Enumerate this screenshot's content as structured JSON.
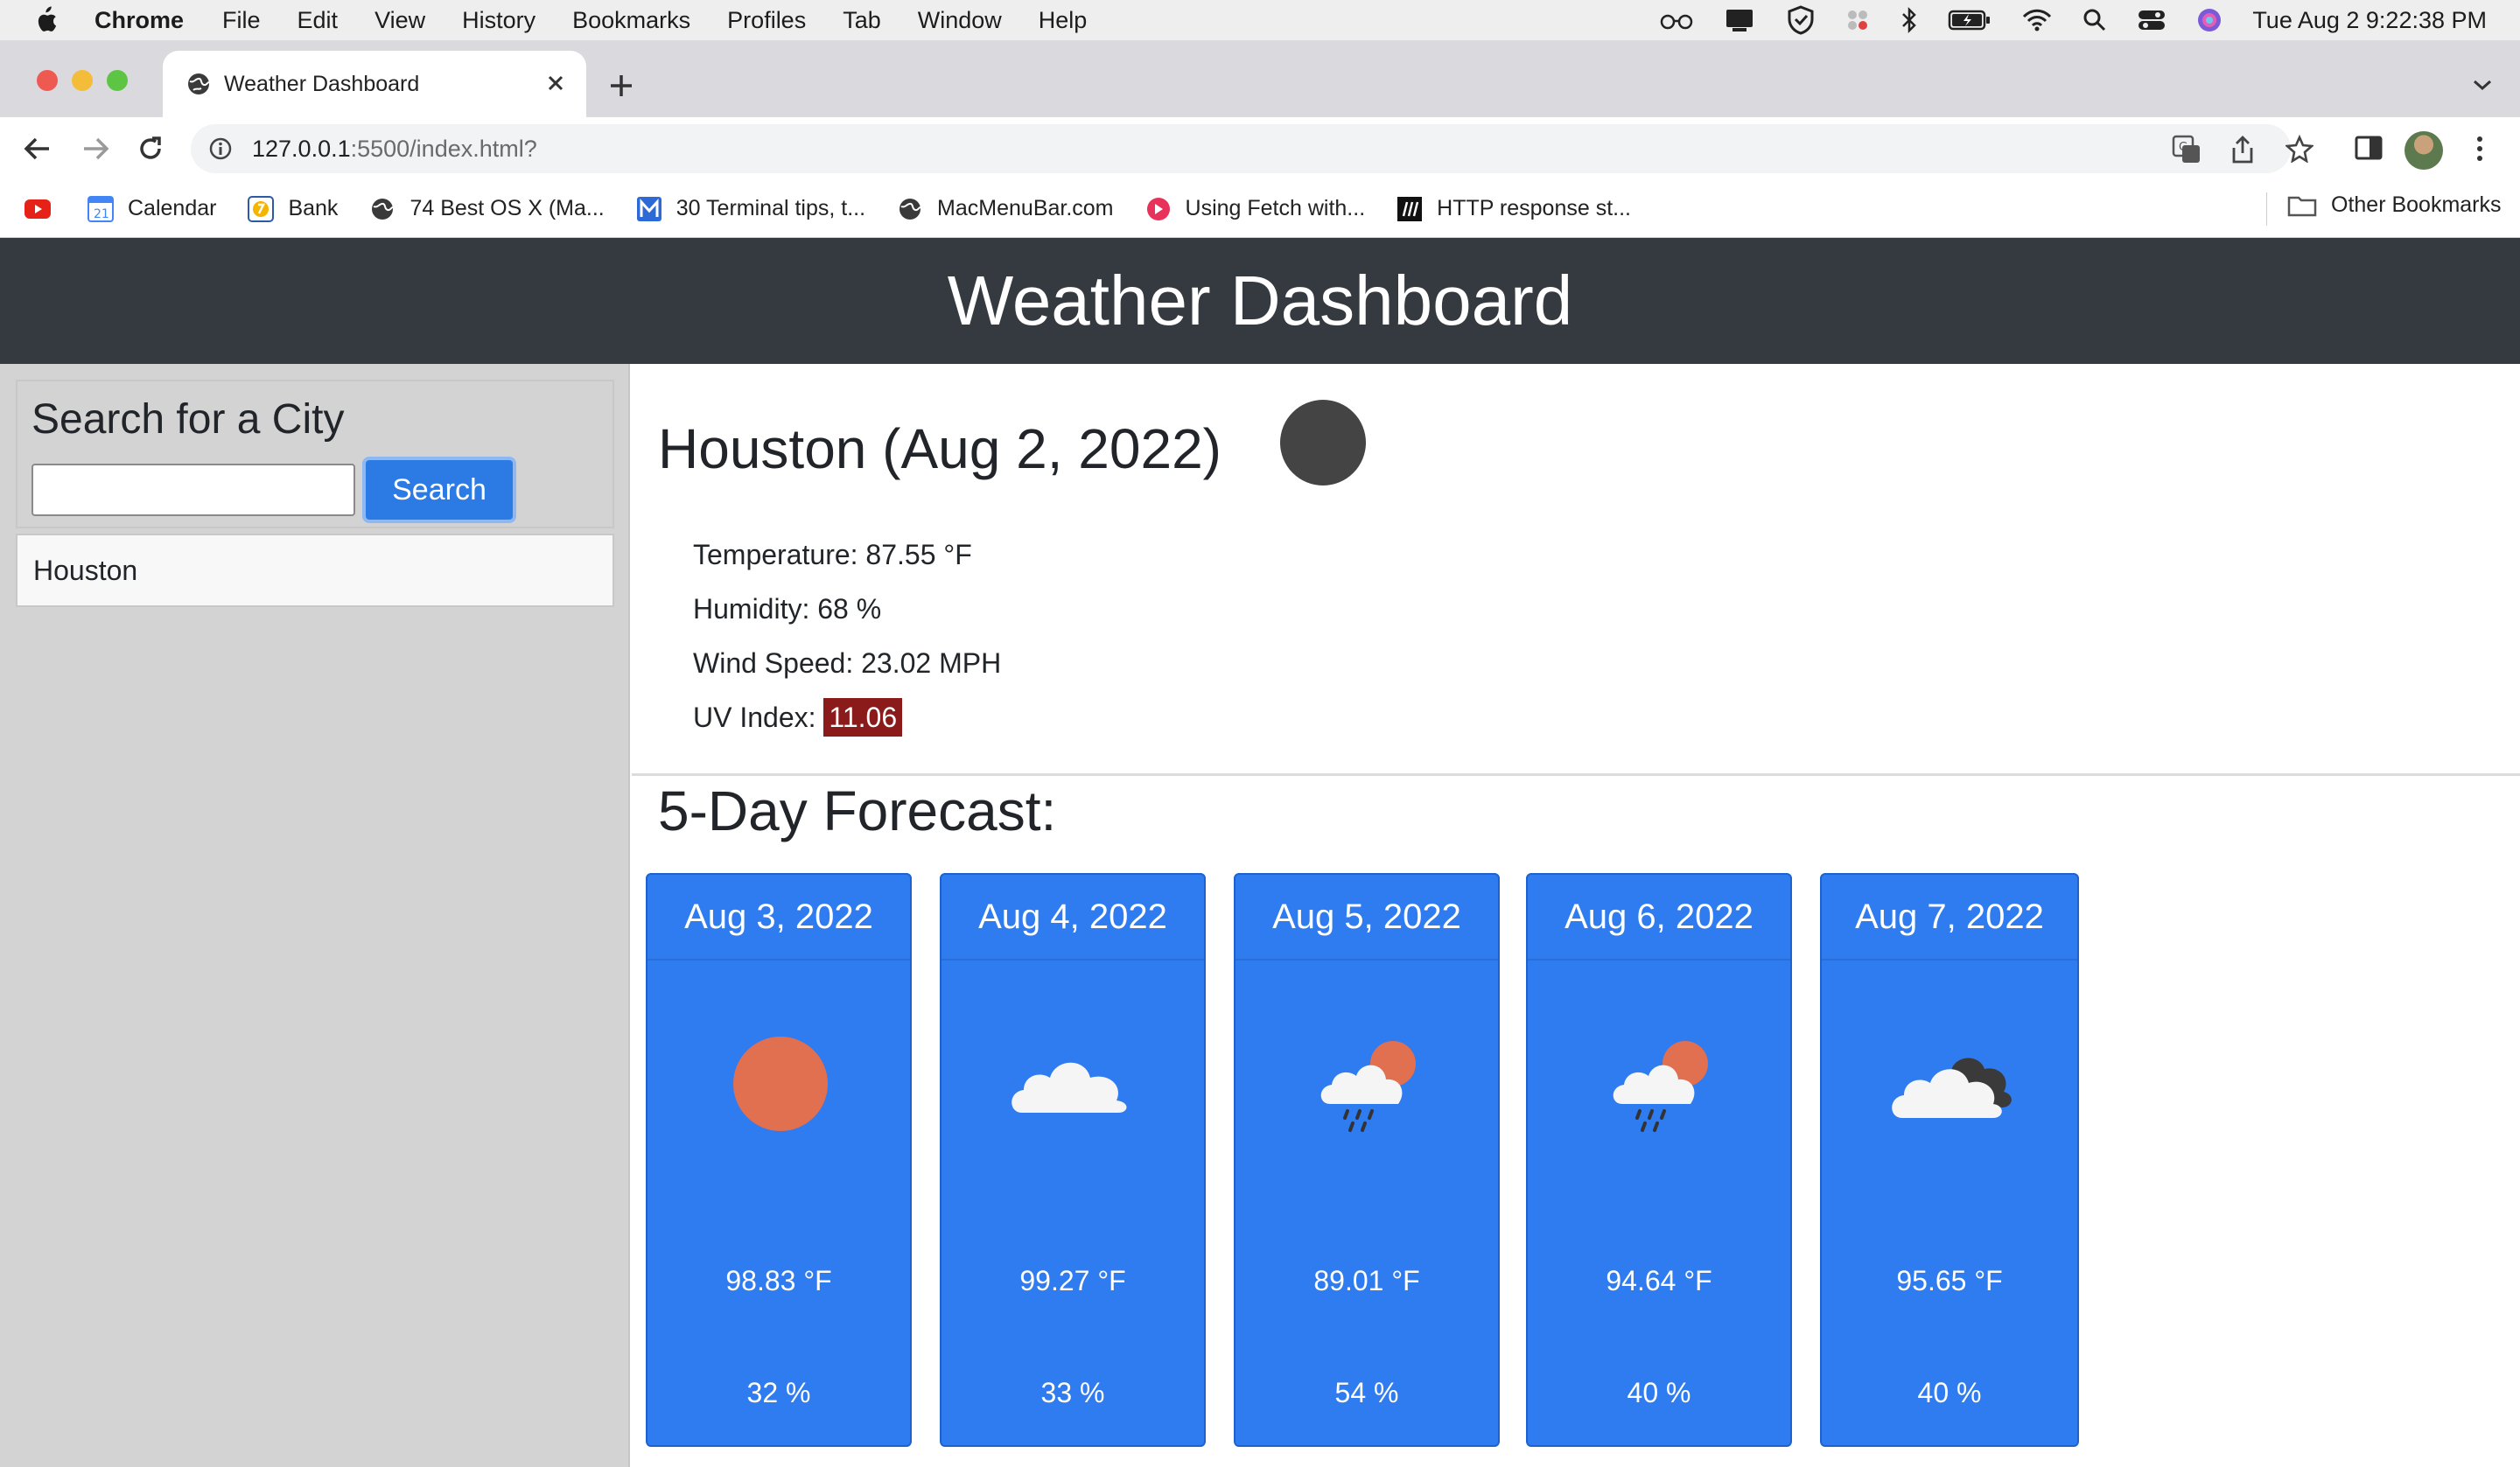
{
  "menubar": {
    "app_name": "Chrome",
    "items": [
      "File",
      "Edit",
      "View",
      "History",
      "Bookmarks",
      "Profiles",
      "Tab",
      "Window",
      "Help"
    ],
    "clock": "Tue Aug 2  9:22:38 PM"
  },
  "browser": {
    "tab_title": "Weather Dashboard",
    "url_host": "127.0.0.1",
    "url_rest": ":5500/index.html?",
    "bookmarks": [
      {
        "label": "",
        "icon": "youtube-icon"
      },
      {
        "label": "Calendar",
        "icon": "calendar-icon"
      },
      {
        "label": "Bank",
        "icon": "bank-icon"
      },
      {
        "label": "74 Best OS X (Ma...",
        "icon": "globe-icon"
      },
      {
        "label": "30 Terminal tips, t...",
        "icon": "m-logo-icon"
      },
      {
        "label": "MacMenuBar.com",
        "icon": "globe-icon"
      },
      {
        "label": "Using Fetch with...",
        "icon": "red-circle-icon"
      },
      {
        "label": "HTTP response st...",
        "icon": "mdn-icon"
      }
    ],
    "other_bookmarks": "Other Bookmarks"
  },
  "page": {
    "header_title": "Weather Dashboard",
    "search": {
      "title": "Search for a City",
      "input_value": "",
      "button_label": "Search"
    },
    "history": [
      "Houston"
    ],
    "current": {
      "city_date": "Houston (Aug 2, 2022)",
      "icon": "dark-circle-icon",
      "temperature": "Temperature: 87.55 °F",
      "humidity": "Humidity: 68 %",
      "wind": "Wind Speed: 23.02 MPH",
      "uv_label": "UV Index: ",
      "uv_value": "11.06",
      "uv_color": "#8b1a1a"
    },
    "forecast_title": "5-Day Forecast:",
    "forecast": [
      {
        "date": "Aug 3, 2022",
        "icon": "sun-icon",
        "temp": "98.83 °F",
        "humidity": "32 %"
      },
      {
        "date": "Aug 4, 2022",
        "icon": "cloud-icon",
        "temp": "99.27 °F",
        "humidity": "33 %"
      },
      {
        "date": "Aug 5, 2022",
        "icon": "rain-sun-icon",
        "temp": "89.01 °F",
        "humidity": "54 %"
      },
      {
        "date": "Aug 6, 2022",
        "icon": "rain-sun-icon",
        "temp": "94.64 °F",
        "humidity": "40 %"
      },
      {
        "date": "Aug 7, 2022",
        "icon": "dark-clouds-icon",
        "temp": "95.65 °F",
        "humidity": "40 %"
      }
    ],
    "colors": {
      "header_bg": "#343a40",
      "sidebar_bg": "#d3d3d3",
      "card_bg": "#2f7bf0",
      "button_bg": "#2c7be5",
      "sun": "#e07050"
    }
  }
}
